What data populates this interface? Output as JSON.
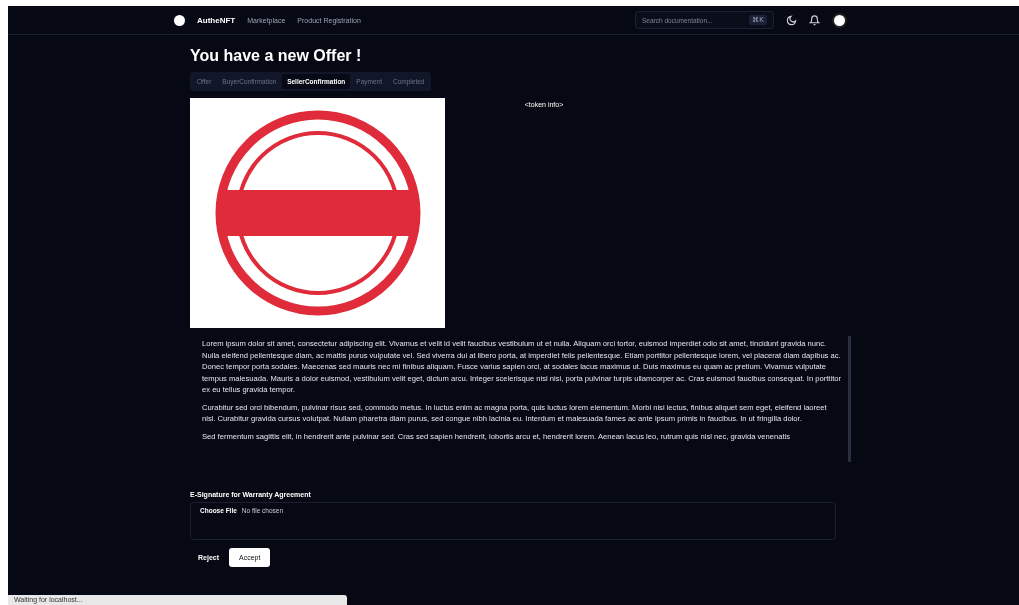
{
  "nav": {
    "brand": "AutheNFT",
    "links": [
      "Marketplace",
      "Product Registration"
    ],
    "search": {
      "placeholder": "Search documentation...",
      "shortcut": "⌘K"
    }
  },
  "title": "You have a new Offer !",
  "tabs": [
    {
      "label": "Offer",
      "selected": false
    },
    {
      "label": "BuyerConfirmation",
      "selected": false
    },
    {
      "label": "SellerConfirmation",
      "selected": true
    },
    {
      "label": "Payment",
      "selected": false
    },
    {
      "label": "Completed",
      "selected": false
    }
  ],
  "token_info": "<token info>",
  "paragraphs": [
    "Lorem ipsum dolor sit amet, consectetur adipiscing elit. Vivamus et velit id velit faucibus vestibulum ut et nulla. Aliquam orci tortor, euismod imperdiet odio sit amet, tincidunt gravida nunc. Nulla eleifend pellentesque diam, ac mattis purus vulputate vel. Sed viverra dui at libero porta, at imperdiet felis pellentesque. Etiam porttitor pellentesque lorem, vel placerat diam dapibus ac. Donec tempor porta sodales. Maecenas sed mauris nec mi finibus aliquam. Fusce varius sapien orci, at sodales lacus maximus ut. Duis maximus eu quam ac pretium. Vivamus vulputate tempus malesuada. Mauris a dolor euismod, vestibulum velit eget, dictum arcu. Integer scelerisque nisi nisi, porta pulvinar turpis ullamcorper ac. Cras euismod faucibus consequat. In porttitor ex eu tellus gravida tempor.",
    "Curabitur sed orci bibendum, pulvinar risus sed, commodo metus. In luctus enim ac magna porta, quis luctus lorem elementum. Morbi nisi lectus, finibus aliquet sem eget, eleifend laoreet nisl. Curabitur gravida cursus volutpat. Nullam pharetra diam purus, sed congue nibh lacinia eu. Interdum et malesuada fames ac ante ipsum primis in faucibus. In ut fringilla dolor.",
    "Sed fermentum sagittis elit, in hendrerit ante pulvinar sed. Cras sed sapien hendrerit, lobortis arcu et, hendrerit lorem. Aenean lacus leo, rutrum quis nisl nec, gravida venenatis"
  ],
  "signature": {
    "label": "E-Signature for Warranty Agreement",
    "button": "Choose File",
    "status": "No file chosen"
  },
  "actions": {
    "reject": "Reject",
    "accept": "Accept"
  },
  "status_bar": "Waiting for localhost..."
}
